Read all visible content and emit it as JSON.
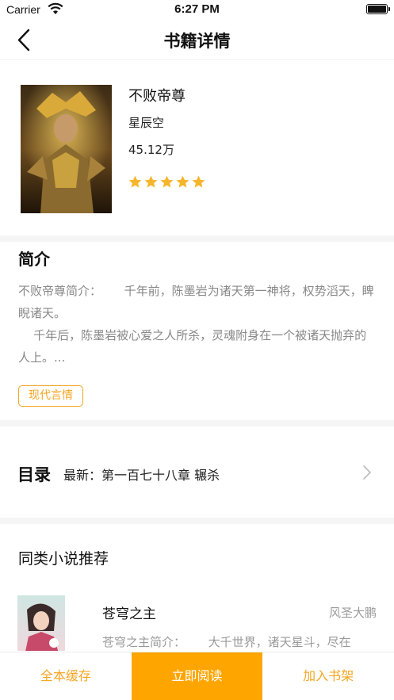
{
  "status_bar": {
    "carrier": "Carrier",
    "time": "6:27 PM"
  },
  "nav": {
    "title": "书籍详情"
  },
  "book": {
    "title": "不败帝尊",
    "author": "星辰空",
    "word_count": "45.12万",
    "rating_stars": 5
  },
  "intro": {
    "heading": "简介",
    "text": "不败帝尊简介：      千年前，陈墨岩为诸天第一神将，权势滔天，睥睨诸天。\n    千年后，陈墨岩被心爱之人所杀，灵魂附身在一个被诸天抛弃的人上。...",
    "tag": "现代言情"
  },
  "toc": {
    "label": "目录",
    "latest": "最新：第一百七十八章 辗杀"
  },
  "recommend": {
    "heading": "同类小说推荐",
    "items": [
      {
        "title": "苍穹之主",
        "author": "风圣大鹏",
        "desc": "苍穹之主简介：      大千世界，诸天星斗，尽在"
      }
    ]
  },
  "bottom_bar": {
    "cache_label": "全本缓存",
    "read_label": "立即阅读",
    "shelf_label": "加入书架"
  },
  "colors": {
    "accent": "#ffa500",
    "accent_text": "#f5a623"
  }
}
